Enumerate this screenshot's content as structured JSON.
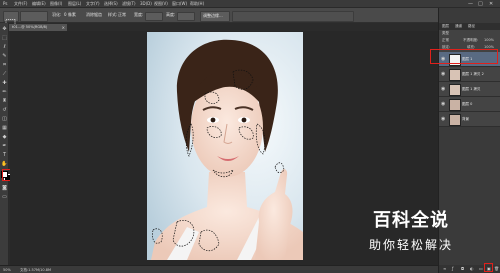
{
  "menubar": {
    "items": [
      "文件(F)",
      "编辑(E)",
      "图像(I)",
      "图层(L)",
      "文字(Y)",
      "选择(S)",
      "滤镜(T)",
      "3D(D)",
      "视图(V)",
      "窗口(W)",
      "帮助(H)"
    ],
    "minimize": "—",
    "maximize": "□",
    "close": "✕"
  },
  "options": {
    "feather_label": "羽化:",
    "feather_value": "0 像素",
    "antialias": "消除锯齿",
    "style_label": "样式:",
    "style_value": "正常",
    "width_label": "宽度:",
    "height_label": "高度:",
    "refine": "调整边缘..."
  },
  "doc_tab": {
    "title": "t01...@ 50%(RGB/8)",
    "close": "×"
  },
  "panels": {
    "tabs": [
      "图层",
      "通道",
      "路径"
    ],
    "kind_label": "类型",
    "blend_mode": "正常",
    "opacity_label": "不透明度:",
    "opacity_value": "100%",
    "lock_label": "锁定:",
    "fill_label": "填充:",
    "fill_value": "100%"
  },
  "layers": [
    {
      "name": "图层 1",
      "selected": true
    },
    {
      "name": "图层 1 拷贝 2",
      "selected": false
    },
    {
      "name": "图层 1 拷贝",
      "selected": false
    },
    {
      "name": "图层 0",
      "selected": false
    },
    {
      "name": "背景",
      "selected": false
    }
  ],
  "status": {
    "zoom": "50%",
    "doc": "文档:1.57M/10.8M"
  },
  "watermark": {
    "title": "百科全说",
    "subtitle": "助你轻松解决"
  },
  "colors": {
    "highlight": "#e0201b",
    "selected_layer": "#596a82"
  }
}
